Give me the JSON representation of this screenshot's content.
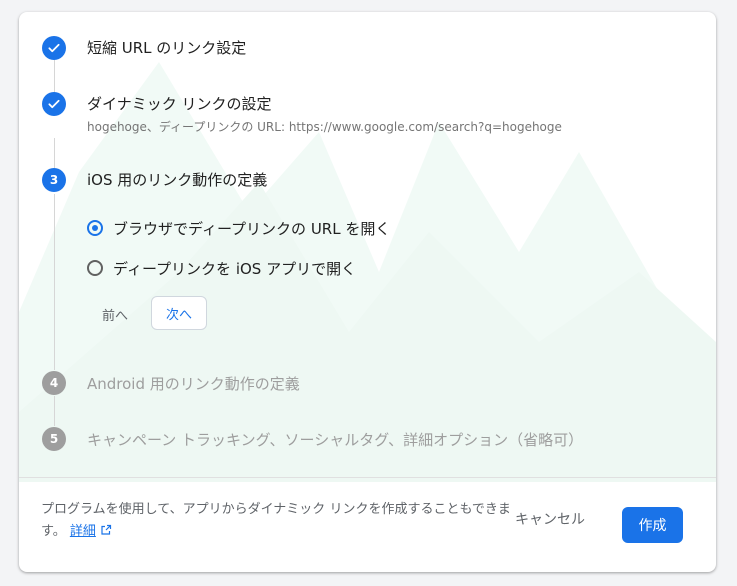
{
  "steps": [
    {
      "number": "1",
      "title": "短縮 URL のリンク設定",
      "state": "done"
    },
    {
      "number": "2",
      "title": "ダイナミック リンクの設定",
      "subtitle": "hogehoge、ディープリンクの URL: https://www.google.com/search?q=hogehoge",
      "state": "done"
    },
    {
      "number": "3",
      "title": "iOS 用のリンク動作の定義",
      "state": "active"
    },
    {
      "number": "4",
      "title": "Android 用のリンク動作の定義",
      "state": "pending"
    },
    {
      "number": "5",
      "title": "キャンペーン トラッキング、ソーシャルタグ、詳細オプション（省略可）",
      "state": "pending"
    }
  ],
  "ios_options": [
    {
      "label": "ブラウザでディープリンクの URL を開く",
      "selected": true
    },
    {
      "label": "ディープリンクを iOS アプリで開く",
      "selected": false
    }
  ],
  "nav": {
    "back_label": "前へ",
    "next_label": "次へ"
  },
  "footer": {
    "description": "プログラムを使用して、アプリからダイナミック リンクを作成することもできます。",
    "details_link": "詳細",
    "cancel_label": "キャンセル",
    "create_label": "作成"
  },
  "colors": {
    "accent": "#1a73e8",
    "pending": "#9e9e9e",
    "bg_art": "#f1faf6"
  }
}
